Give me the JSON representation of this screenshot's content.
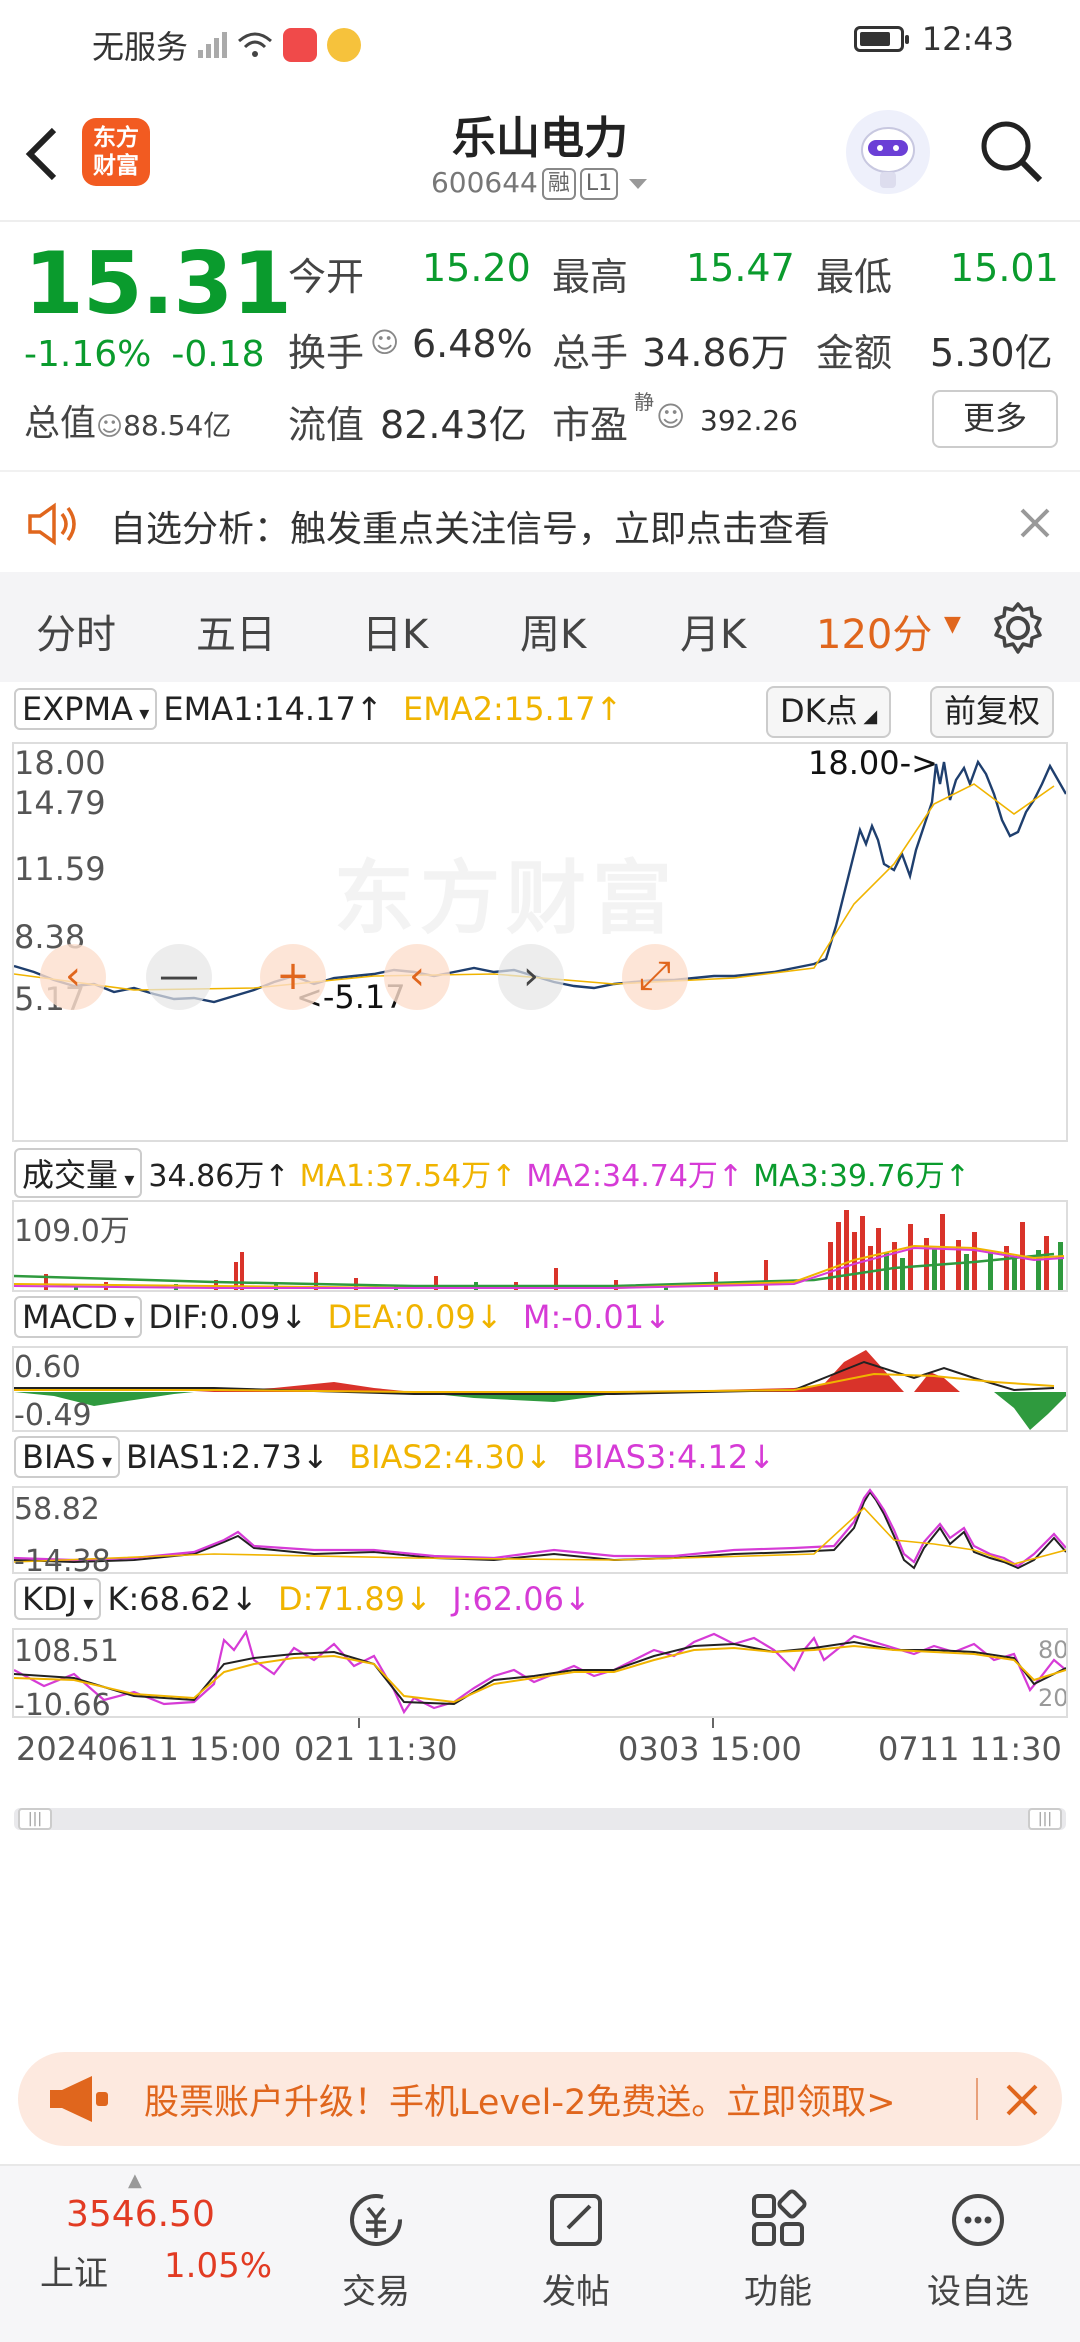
{
  "status_bar": {
    "carrier": "无服务",
    "time": "12:43"
  },
  "header": {
    "back_icon": "chevron-left-icon",
    "logo_text": "东方财富",
    "title": "乐山电力",
    "code": "600644",
    "badge_rong": "融",
    "badge_level": "L1"
  },
  "quote": {
    "price": "15.31",
    "change_pct": "-1.16%",
    "change": "-0.18",
    "open_label": "今开",
    "open": "15.20",
    "high_label": "最高",
    "high": "15.47",
    "low_label": "最低",
    "low": "15.01",
    "turnover_label": "换手",
    "turnover": "6.48%",
    "volume_label": "总手",
    "volume": "34.86万",
    "amount_label": "金额",
    "amount": "5.30亿",
    "mktcap_label": "总值",
    "mktcap": "88.54亿",
    "float_label": "流值",
    "float": "82.43亿",
    "pe_label": "市盈",
    "pe_sup": "静",
    "pe": "392.26",
    "more": "更多"
  },
  "notice": {
    "text": "自选分析：触发重点关注信号，立即点击查看"
  },
  "tabs": [
    "分时",
    "五日",
    "日K",
    "周K",
    "月K",
    "120分"
  ],
  "main_chart": {
    "indicator": "EXPMA",
    "ema1": "EMA1:14.17↑",
    "ema2": "EMA2:15.17↑",
    "dk_button": "DK点",
    "adjust_button": "前复权",
    "y_labels": [
      "18.00",
      "14.79",
      "11.59",
      "8.38",
      "5.17"
    ],
    "max_marker": "18.00->",
    "min_marker": "<-5.17",
    "watermark": "东方财富"
  },
  "volume_chart": {
    "indicator": "成交量",
    "value": "34.86万↑",
    "ma1": "MA1:37.54万↑",
    "ma2": "MA2:34.74万↑",
    "ma3": "MA3:39.76万↑",
    "y_top": "109.0万"
  },
  "macd_chart": {
    "indicator": "MACD",
    "dif": "DIF:0.09↓",
    "dea": "DEA:0.09↓",
    "m": "M:-0.01↓",
    "y_top": "0.60",
    "y_bottom": "-0.49"
  },
  "bias_chart": {
    "indicator": "BIAS",
    "bias1": "BIAS1:2.73↓",
    "bias2": "BIAS2:4.30↓",
    "bias3": "BIAS3:4.12↓",
    "y_top": "58.82",
    "y_bottom": "-14.38"
  },
  "kdj_chart": {
    "indicator": "KDJ",
    "k": "K:68.62↓",
    "d": "D:71.89↓",
    "j": "J:62.06↓",
    "y_top": "108.51",
    "y_bottom": "-10.66",
    "right_top": "80",
    "right_bottom": "20"
  },
  "x_axis": [
    "20240611 15:00",
    "021 11:30",
    "0303 15:00",
    "0711 11:30"
  ],
  "promo": {
    "text": "股票账户升级！手机Level-2免费送。立即领取>"
  },
  "bottom_nav": {
    "index_value": "3546.50",
    "index_name": "上证",
    "index_change": "1.05%",
    "items": [
      "交易",
      "发帖",
      "功能",
      "设自选"
    ]
  },
  "colors": {
    "accent": "#e0661d",
    "down": "#0a9b2d",
    "up": "#e23b23",
    "price_line": "#1f3f6e",
    "ema2": "#f0b400",
    "ma2": "#d63bd6"
  }
}
